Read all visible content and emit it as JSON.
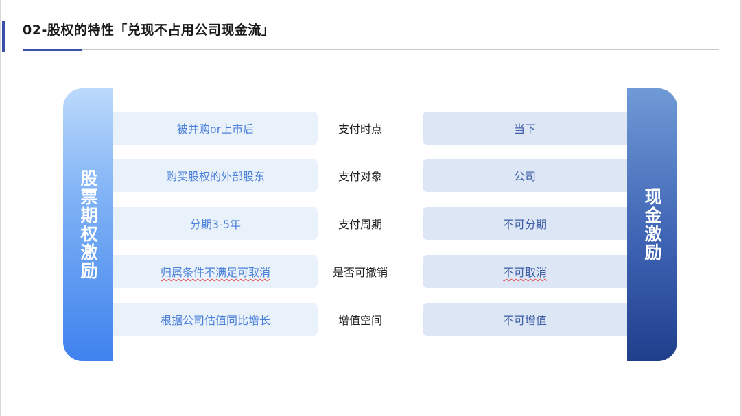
{
  "title": "02-股权的特性「兑现不占用公司现金流」",
  "left_label": "股票期权激励",
  "right_label": "现金激励",
  "rows": [
    {
      "left": "被并购or上市后",
      "criterion": "支付时点",
      "right": "当下"
    },
    {
      "left": "购买股权的外部股东",
      "criterion": "支付对象",
      "right": "公司"
    },
    {
      "left": "分期3-5年",
      "criterion": "支付周期",
      "right": "不可分期"
    },
    {
      "left": "归属条件不满足可取消",
      "criterion": "是否可撤销",
      "right": "不可取消"
    },
    {
      "left": "根据公司估值同比增长",
      "criterion": "增值空间",
      "right": "不可增值"
    }
  ]
}
